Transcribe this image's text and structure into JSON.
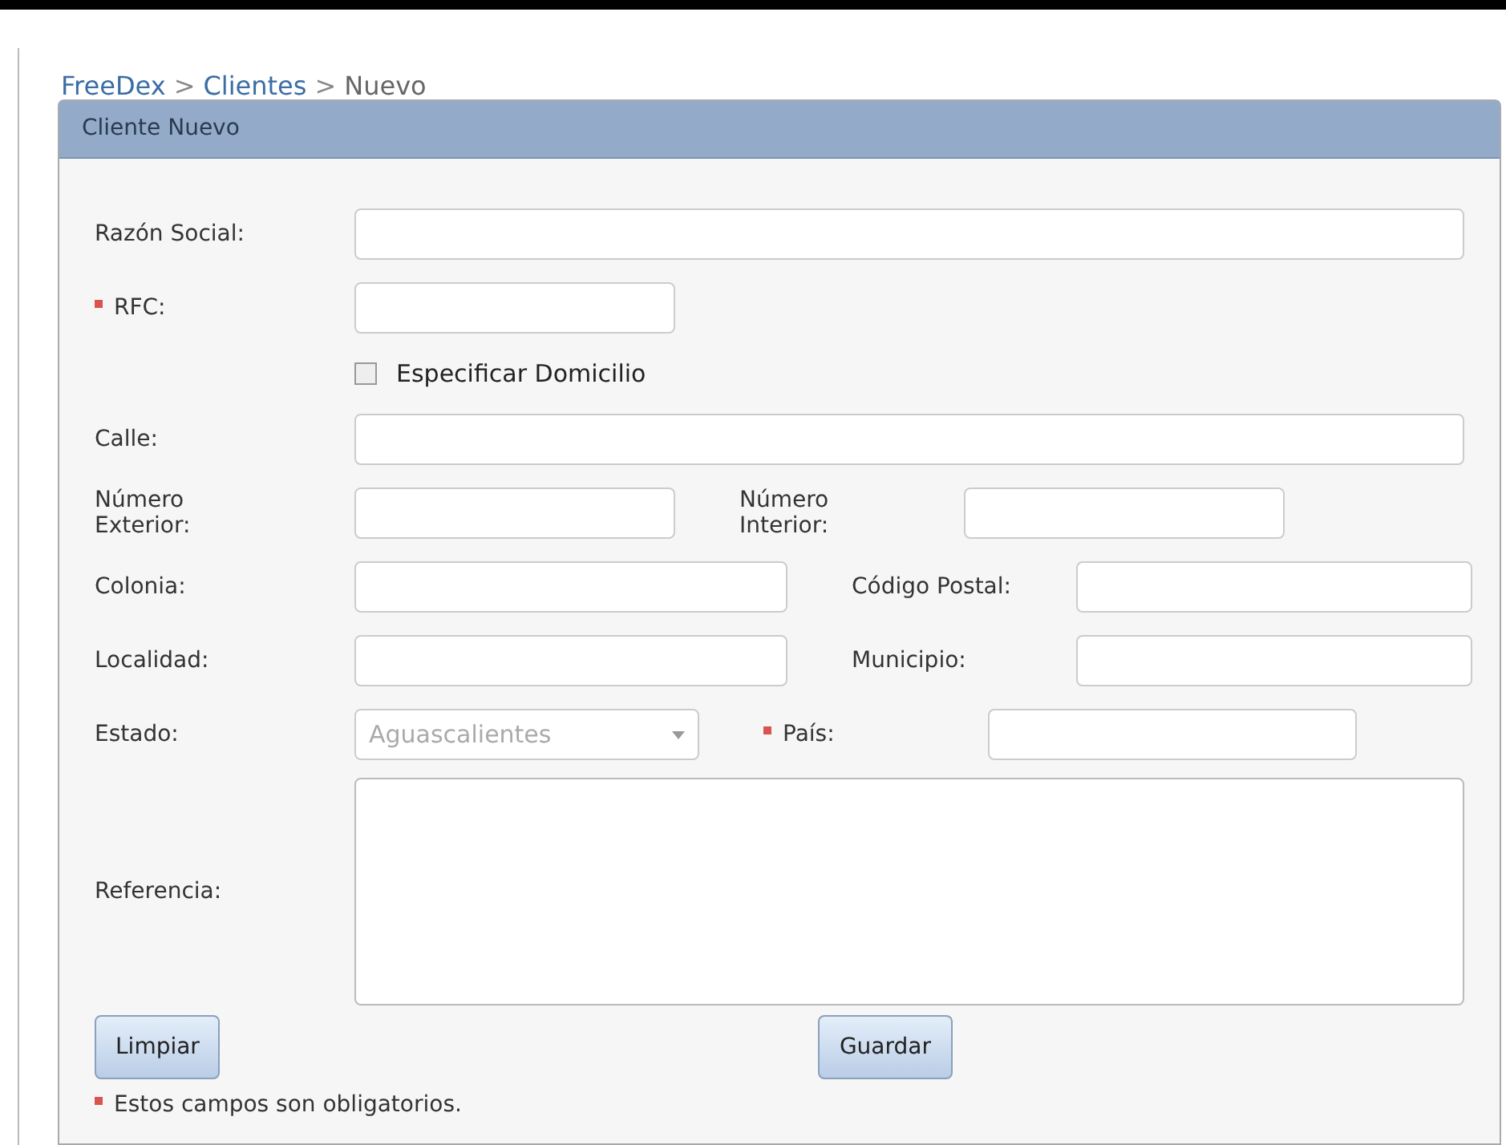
{
  "breadcrumb": [
    {
      "kind": "link",
      "text": "FreeDex"
    },
    {
      "kind": "separator",
      "text": ">"
    },
    {
      "kind": "link",
      "text": "Clientes"
    },
    {
      "kind": "separator",
      "text": ">"
    },
    {
      "kind": "current",
      "text": "Nuevo"
    }
  ],
  "panel": {
    "title": "Cliente Nuevo",
    "rows": [
      {
        "fields": [
          {
            "kind": "text",
            "label": "Razón Social:",
            "required": false
          }
        ]
      },
      {
        "fields": [
          {
            "kind": "text",
            "label": "RFC:",
            "required": true
          }
        ]
      },
      {
        "fields": [
          {
            "kind": "checkbox",
            "label": "Especificar Domicilio",
            "checked": false
          }
        ]
      },
      {
        "fields": [
          {
            "kind": "text",
            "label": "Calle:",
            "required": false
          }
        ]
      },
      {
        "fields": [
          {
            "kind": "text",
            "label": "Número Exterior:",
            "required": false
          },
          {
            "kind": "text",
            "label": "Número Interior:",
            "required": false
          }
        ]
      },
      {
        "fields": [
          {
            "kind": "text",
            "label": "Colonia:",
            "required": false
          },
          {
            "kind": "text",
            "label": "Código Postal:",
            "required": false
          }
        ]
      },
      {
        "fields": [
          {
            "kind": "text",
            "label": "Localidad:",
            "required": false
          },
          {
            "kind": "text",
            "label": "Municipio:",
            "required": false
          }
        ]
      },
      {
        "fields": [
          {
            "kind": "select",
            "label": "Estado:",
            "required": false,
            "value": "Aguascalientes",
            "disabled": true
          },
          {
            "kind": "text",
            "label": "País:",
            "required": true
          }
        ]
      },
      {
        "fields": [
          {
            "kind": "textarea",
            "label": "Referencia:",
            "required": false
          }
        ]
      }
    ],
    "buttons": [
      "Limpiar",
      "Guardar"
    ],
    "note": "Estos campos son obligatorios."
  }
}
